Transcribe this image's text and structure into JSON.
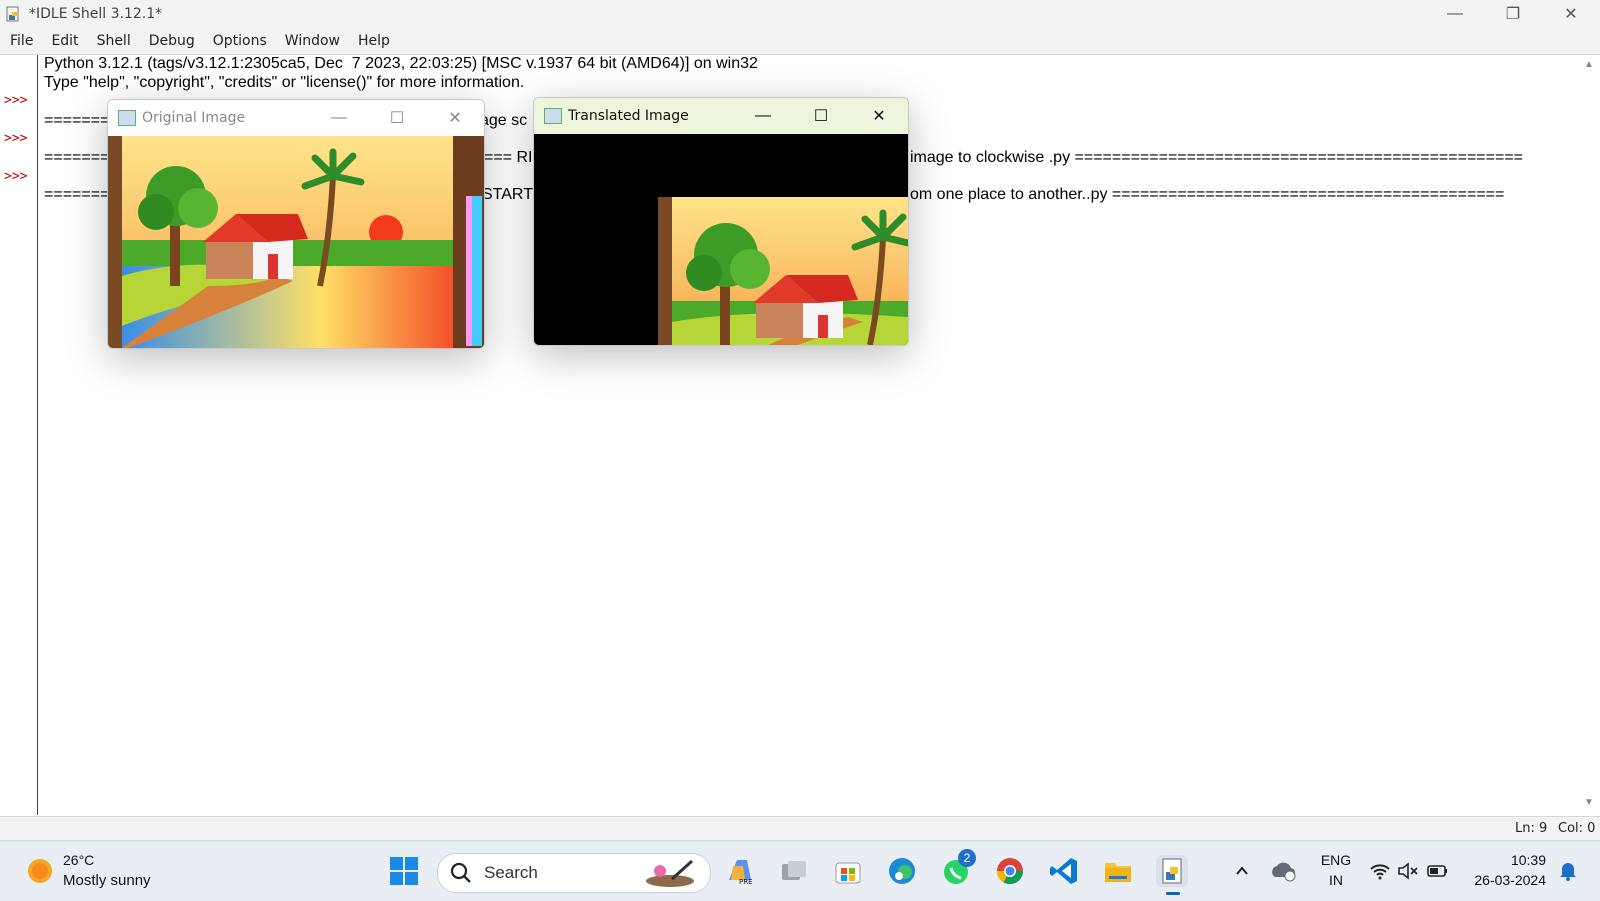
{
  "window": {
    "title": "*IDLE Shell 3.12.1*",
    "controls": {
      "minimize": "—",
      "restore": "❐",
      "close": "✕"
    }
  },
  "menu": [
    "File",
    "Edit",
    "Shell",
    "Debug",
    "Options",
    "Window",
    "Help"
  ],
  "shell": {
    "lines": [
      "Python 3.12.1 (tags/v3.12.1:2305ca5, Dec  7 2023, 22:03:25) [MSC v.1937 64 bit (AMD64)] on win32",
      "Type \"help\", \"copyright\", \"credits\" or \"license()\" for more information.",
      "=======",
      "age sc",
      "=======",
      "=== RI",
      "image to clockwise .py ================================================",
      "=======",
      "START",
      "om one place to another..py =========================================="
    ],
    "prompts": [
      ">>>",
      ">>>",
      ">>>"
    ]
  },
  "status": {
    "line": "Ln: 9",
    "col": "Col: 0"
  },
  "image_windows": [
    {
      "title": "Original Image",
      "state": "inactive"
    },
    {
      "title": "Translated Image",
      "state": "active"
    }
  ],
  "taskbar": {
    "weather_temp": "26°C",
    "weather_desc": "Mostly sunny",
    "search_label": "Search",
    "whatsapp_badge": "2",
    "lang_top": "ENG",
    "lang_bottom": "IN",
    "time": "10:39",
    "date": "26-03-2024"
  },
  "colors": {
    "prompt": "#c00000",
    "accent": "#0067c0",
    "titlebar": "#f3f3f3"
  }
}
